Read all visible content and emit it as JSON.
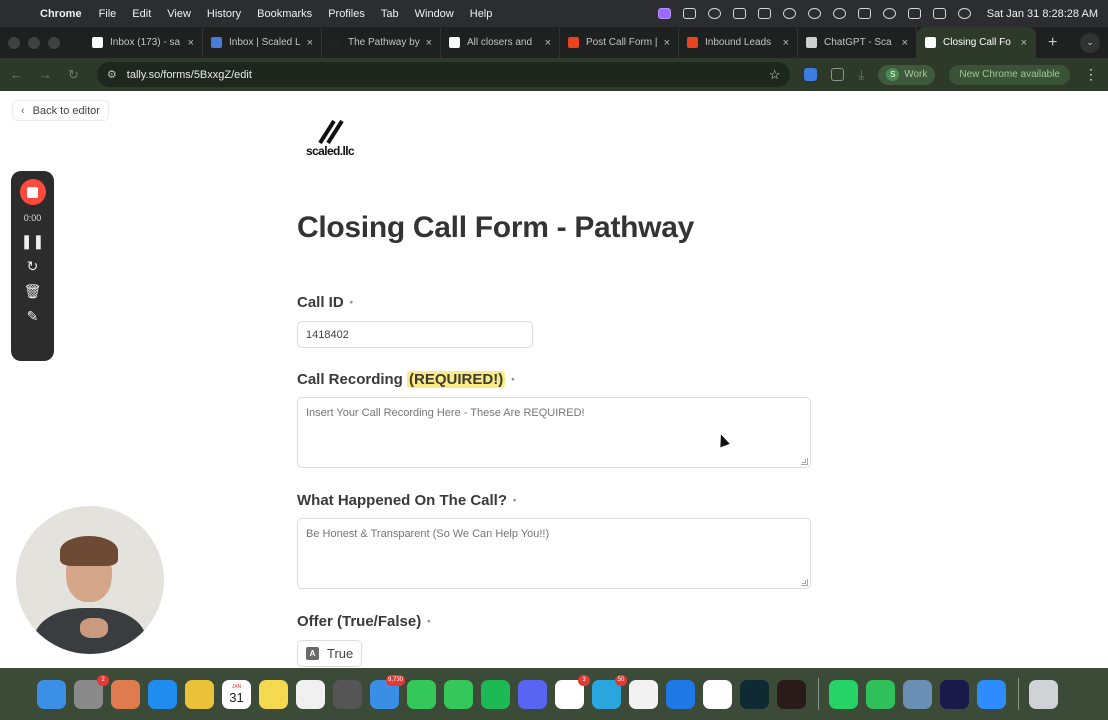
{
  "menubar": {
    "app": "Chrome",
    "items": [
      "File",
      "Edit",
      "View",
      "History",
      "Bookmarks",
      "Profiles",
      "Tab",
      "Window",
      "Help"
    ],
    "clock": "Sat Jan 31  8:28:28 AM"
  },
  "tabs": [
    {
      "label": "Inbox (173) - sa",
      "favicon": "gmail-icon",
      "color": "#ffffff"
    },
    {
      "label": "Inbox | Scaled L",
      "favicon": "mail-icon",
      "color": "#4a7bd8"
    },
    {
      "label": "The Pathway by",
      "favicon": "pathway-icon",
      "color": "#222222"
    },
    {
      "label": "All closers and",
      "favicon": "triangle-icon",
      "color": "#ffffff"
    },
    {
      "label": "Post Call Form |",
      "favicon": "form-icon",
      "color": "#e8451e"
    },
    {
      "label": "Inbound Leads",
      "favicon": "sheet-icon",
      "color": "#e8451e"
    },
    {
      "label": "ChatGPT - Sca",
      "favicon": "chatgpt-icon",
      "color": "#cfcfcf"
    },
    {
      "label": "Closing Call Fo",
      "favicon": "tally-icon",
      "color": "#ffffff",
      "active": true
    }
  ],
  "toolbar": {
    "url": "tally.so/forms/5BxxgZ/edit",
    "profile_initial": "S",
    "profile_label": "Work",
    "update_label": "New Chrome available"
  },
  "page": {
    "back_label": "Back to editor",
    "logo_text": "scaled.llc",
    "title": "Closing Call Form - Pathway",
    "call_id": {
      "label": "Call ID",
      "value": "1418402",
      "required_mark": "•"
    },
    "recording": {
      "label": "Call Recording",
      "highlight": "(REQUIRED!)",
      "required_mark": "•",
      "placeholder": "Insert Your Call Recording Here - These Are REQUIRED!"
    },
    "happened": {
      "label": "What Happened On The Call?",
      "required_mark": "•",
      "placeholder": "Be Honest & Transparent (So We Can Help You!!)"
    },
    "offer": {
      "label": "Offer (True/False)",
      "required_mark": "•",
      "option_key": "A",
      "option_label": "True"
    }
  },
  "recorder": {
    "time": "0:00"
  },
  "dock": [
    {
      "name": "finder-icon",
      "color": "#3b8fe6"
    },
    {
      "name": "system-settings-icon",
      "color": "#8a8a8a",
      "badge": "2"
    },
    {
      "name": "launchpad-icon",
      "color": "#e07a4f"
    },
    {
      "name": "app-store-icon",
      "color": "#1f8cf0"
    },
    {
      "name": "chrome-icon",
      "color": "#e9c23a"
    },
    {
      "name": "calendar-icon",
      "color": "#ffffff",
      "cal_month": "JAN",
      "cal_day": "31"
    },
    {
      "name": "notes-icon",
      "color": "#f5d94e"
    },
    {
      "name": "freeform-icon",
      "color": "#f0f0f0"
    },
    {
      "name": "calculator-icon",
      "color": "#555555"
    },
    {
      "name": "mail-icon",
      "color": "#3a8ee6",
      "badge": "9,730"
    },
    {
      "name": "facetime-icon",
      "color": "#34c759"
    },
    {
      "name": "messages-icon",
      "color": "#34c759"
    },
    {
      "name": "spotify-icon",
      "color": "#1db954"
    },
    {
      "name": "discord-icon",
      "color": "#5865f2"
    },
    {
      "name": "slack-icon",
      "color": "#ffffff",
      "badge": "3"
    },
    {
      "name": "telegram-icon",
      "color": "#2aa6df",
      "badge": "50"
    },
    {
      "name": "photos-icon",
      "color": "#f2f2f2"
    },
    {
      "name": "gear-app-icon",
      "color": "#1e78e6"
    },
    {
      "name": "notion-icon",
      "color": "#ffffff"
    },
    {
      "name": "wave-app-icon",
      "color": "#0f2a33"
    },
    {
      "name": "recorder-app-icon",
      "color": "#2a1a1a"
    },
    {
      "name": "whatsapp-icon",
      "color": "#25d366",
      "sep_before": true
    },
    {
      "name": "numbers-icon",
      "color": "#30c15a"
    },
    {
      "name": "preview-icon",
      "color": "#6a8fb5"
    },
    {
      "name": "screen-app-icon",
      "color": "#1a1a4a"
    },
    {
      "name": "zoom-icon",
      "color": "#2d8cff"
    },
    {
      "name": "trash-icon",
      "color": "#cfd3d6",
      "sep_before": true
    }
  ]
}
